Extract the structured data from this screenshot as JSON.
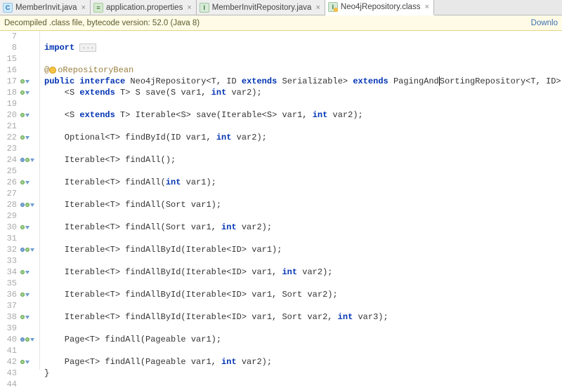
{
  "tabs": [
    {
      "label": "MemberInvit.java",
      "kind": "c"
    },
    {
      "label": "application.properties",
      "kind": "p"
    },
    {
      "label": "MemberInvitRepository.java",
      "kind": "i"
    },
    {
      "label": "Neo4jRepository.class",
      "kind": "cl",
      "active": true
    }
  ],
  "banner": {
    "text": "Decompiled .class file, bytecode version: 52.0 (Java 8)",
    "link": "Downlo"
  },
  "lines": [
    {
      "n": 7,
      "marks": [],
      "html": ""
    },
    {
      "n": 8,
      "marks": [],
      "html": "<span class='kw'>import</span> <span class='fold'>...</span>"
    },
    {
      "n": 15,
      "marks": [],
      "html": ""
    },
    {
      "n": 16,
      "marks": [],
      "html": "@<span class='lightbulb'></span>oRepositoryBean",
      "ann": true
    },
    {
      "n": 17,
      "marks": [
        "b",
        "i"
      ],
      "html": "<span class='kw'>public</span> <span class='kw'>interface</span> Neo4jRepository&lt;T, ID <span class='kw'>extends</span> Serializable&gt; <span class='kw'>extends</span> PagingAnd<span class='cursor'></span>SortingRepository&lt;T, ID&gt; {"
    },
    {
      "n": 18,
      "marks": [
        "b",
        "i"
      ],
      "html": "    &lt;S <span class='kw'>extends</span> T&gt; S save(S var1, <span class='kw'>int</span> var2);"
    },
    {
      "n": 19,
      "marks": [],
      "html": ""
    },
    {
      "n": 20,
      "marks": [
        "b",
        "i"
      ],
      "html": "    &lt;S <span class='kw'>extends</span> T&gt; Iterable&lt;S&gt; save(Iterable&lt;S&gt; var1, <span class='kw'>int</span> var2);"
    },
    {
      "n": 21,
      "marks": [],
      "html": ""
    },
    {
      "n": 22,
      "marks": [
        "b",
        "i"
      ],
      "html": "    Optional&lt;T&gt; findById(ID var1, <span class='kw'>int</span> var2);"
    },
    {
      "n": 23,
      "marks": [],
      "html": ""
    },
    {
      "n": 24,
      "marks": [
        "u",
        "b",
        "i"
      ],
      "html": "    Iterable&lt;T&gt; findAll();"
    },
    {
      "n": 25,
      "marks": [],
      "html": ""
    },
    {
      "n": 26,
      "marks": [
        "b",
        "i"
      ],
      "html": "    Iterable&lt;T&gt; findAll(<span class='kw'>int</span> var1);"
    },
    {
      "n": 27,
      "marks": [],
      "html": ""
    },
    {
      "n": 28,
      "marks": [
        "u",
        "b",
        "i"
      ],
      "html": "    Iterable&lt;T&gt; findAll(Sort var1);"
    },
    {
      "n": 29,
      "marks": [],
      "html": ""
    },
    {
      "n": 30,
      "marks": [
        "b",
        "i"
      ],
      "html": "    Iterable&lt;T&gt; findAll(Sort var1, <span class='kw'>int</span> var2);"
    },
    {
      "n": 31,
      "marks": [],
      "html": ""
    },
    {
      "n": 32,
      "marks": [
        "u",
        "b",
        "i"
      ],
      "html": "    Iterable&lt;T&gt; findAllById(Iterable&lt;ID&gt; var1);"
    },
    {
      "n": 33,
      "marks": [],
      "html": ""
    },
    {
      "n": 34,
      "marks": [
        "b",
        "i"
      ],
      "html": "    Iterable&lt;T&gt; findAllById(Iterable&lt;ID&gt; var1, <span class='kw'>int</span> var2);"
    },
    {
      "n": 35,
      "marks": [],
      "html": ""
    },
    {
      "n": 36,
      "marks": [
        "b",
        "i"
      ],
      "html": "    Iterable&lt;T&gt; findAllById(Iterable&lt;ID&gt; var1, Sort var2);"
    },
    {
      "n": 37,
      "marks": [],
      "html": ""
    },
    {
      "n": 38,
      "marks": [
        "b",
        "i"
      ],
      "html": "    Iterable&lt;T&gt; findAllById(Iterable&lt;ID&gt; var1, Sort var2, <span class='kw'>int</span> var3);"
    },
    {
      "n": 39,
      "marks": [],
      "html": ""
    },
    {
      "n": 40,
      "marks": [
        "u",
        "b",
        "i"
      ],
      "html": "    Page&lt;T&gt; findAll(Pageable var1);"
    },
    {
      "n": 41,
      "marks": [],
      "html": ""
    },
    {
      "n": 42,
      "marks": [
        "b",
        "i"
      ],
      "html": "    Page&lt;T&gt; findAll(Pageable var1, <span class='kw'>int</span> var2);"
    },
    {
      "n": 43,
      "marks": [],
      "html": "}"
    },
    {
      "n": 44,
      "marks": [],
      "html": ""
    }
  ]
}
